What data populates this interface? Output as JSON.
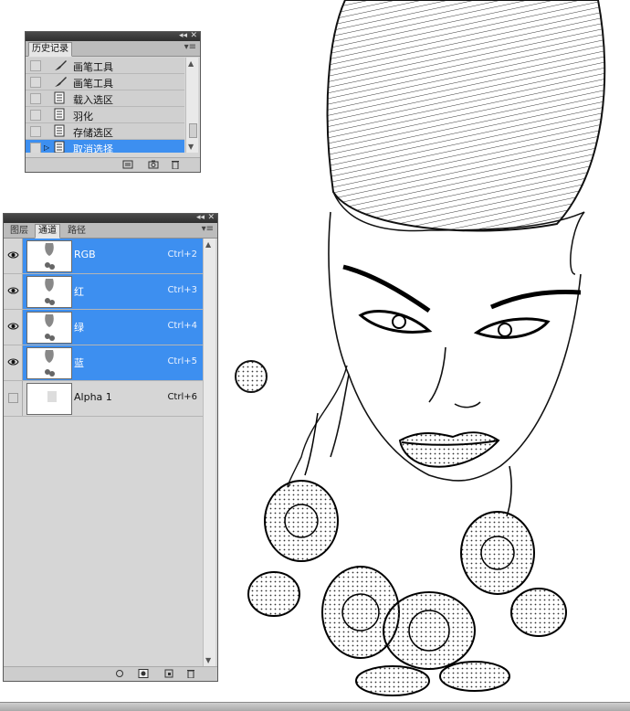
{
  "history_panel": {
    "tab": "历史记录",
    "items": [
      {
        "label": "画笔工具",
        "icon": "brush-icon",
        "selected": false
      },
      {
        "label": "画笔工具",
        "icon": "brush-icon",
        "selected": false
      },
      {
        "label": "载入选区",
        "icon": "document-icon",
        "selected": false
      },
      {
        "label": "羽化",
        "icon": "document-icon",
        "selected": false
      },
      {
        "label": "存储选区",
        "icon": "document-icon",
        "selected": false
      },
      {
        "label": "取消选择",
        "icon": "document-icon",
        "selected": true
      }
    ],
    "footer_icons": [
      "new-document-from-state-icon",
      "camera-snapshot-icon",
      "trash-icon"
    ]
  },
  "channels_panel": {
    "tabs": [
      {
        "label": "图层",
        "active": false
      },
      {
        "label": "通道",
        "active": true
      },
      {
        "label": "路径",
        "active": false
      }
    ],
    "channels": [
      {
        "name": "RGB",
        "shortcut": "Ctrl+2",
        "visible": true,
        "selected": true
      },
      {
        "name": "红",
        "shortcut": "Ctrl+3",
        "visible": true,
        "selected": true
      },
      {
        "name": "绿",
        "shortcut": "Ctrl+4",
        "visible": true,
        "selected": true
      },
      {
        "name": "蓝",
        "shortcut": "Ctrl+5",
        "visible": true,
        "selected": true
      },
      {
        "name": "Alpha 1",
        "shortcut": "Ctrl+6",
        "visible": false,
        "selected": false
      }
    ],
    "footer_icons": [
      "load-selection-icon",
      "save-selection-icon",
      "new-channel-icon",
      "trash-icon"
    ]
  },
  "colors": {
    "selection": "#3d8ff0",
    "panel_bg": "#d6d6d6",
    "titlebar": "#333333"
  }
}
